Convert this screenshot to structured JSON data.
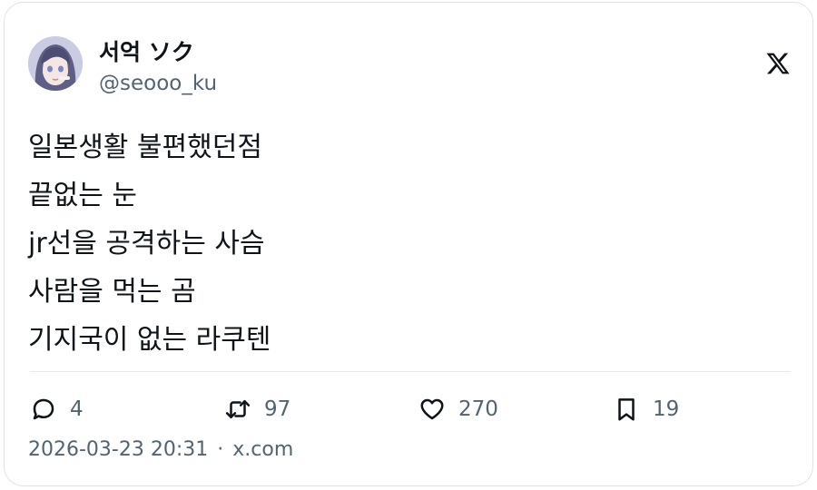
{
  "author": {
    "display_name": "서억 ソク",
    "handle": "@seooo_ku",
    "avatar_icon": "anime-girl-avatar"
  },
  "post": {
    "lines": [
      "일본생활 불편했던점",
      "끝없는 눈",
      "jr선을 공격하는 사슴",
      "사람을 먹는 곰",
      "기지국이 없는 라쿠텐"
    ]
  },
  "actions": {
    "replies": "4",
    "reposts": "97",
    "likes": "270",
    "bookmarks": "19"
  },
  "meta": {
    "timestamp": "2026-03-23 20:31",
    "separator": "·",
    "source": "x.com"
  },
  "colors": {
    "text": "#0f1419",
    "secondary": "#536471",
    "border": "#dfe3e7"
  }
}
